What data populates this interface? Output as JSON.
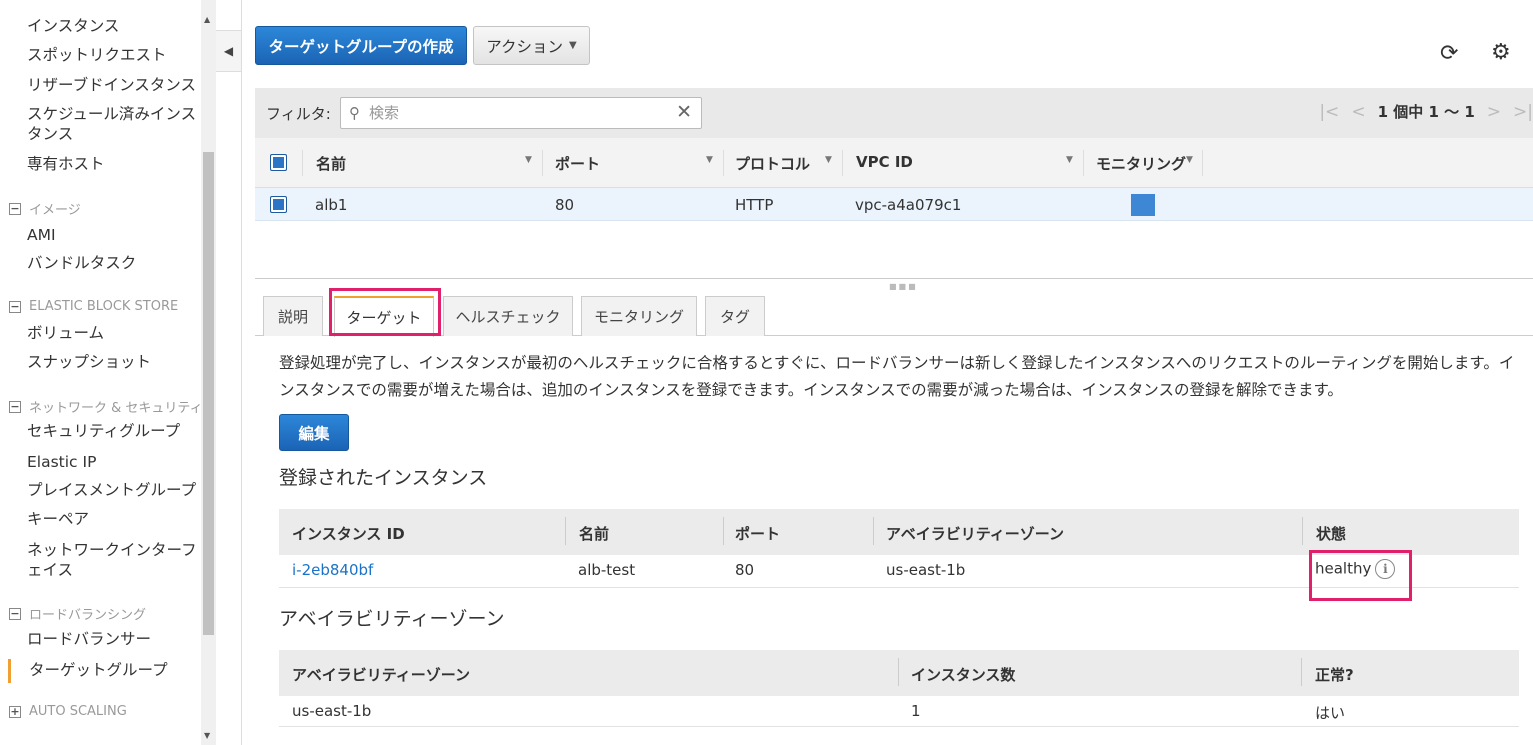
{
  "sidebar": {
    "items_top": [
      "インスタンス",
      "スポットリクエスト",
      "リザーブドインスタンス",
      "スケジュール済みインスタンス",
      "専有ホスト"
    ],
    "sec_images": "イメージ",
    "images_items": [
      "AMI",
      "バンドルタスク"
    ],
    "sec_ebs": "ELASTIC BLOCK STORE",
    "ebs_items": [
      "ボリューム",
      "スナップショット"
    ],
    "sec_network": "ネットワーク & セキュリティ",
    "network_items": [
      "セキュリティグループ",
      "Elastic IP",
      "プレイスメントグループ",
      "キーペア",
      "ネットワークインターフェイス"
    ],
    "sec_lb": "ロードバランシング",
    "lb_items": [
      "ロードバランサー",
      "ターゲットグループ"
    ],
    "sec_as": "AUTO SCALING"
  },
  "toolbar": {
    "create_label": "ターゲットグループの作成",
    "actions_label": "アクション"
  },
  "filter": {
    "label": "フィルタ:",
    "placeholder": "検索",
    "pager_text": "1 個中 1 〜 1"
  },
  "grid": {
    "columns": [
      "名前",
      "ポート",
      "プロトコル",
      "VPC ID",
      "モニタリング"
    ],
    "row": {
      "name": "alb1",
      "port": "80",
      "protocol": "HTTP",
      "vpc": "vpc-a4a079c1"
    }
  },
  "tabs": [
    "説明",
    "ターゲット",
    "ヘルスチェック",
    "モニタリング",
    "タグ"
  ],
  "targets": {
    "description": "登録処理が完了し、インスタンスが最初のヘルスチェックに合格するとすぐに、ロードバランサーは新しく登録したインスタンスへのリクエストのルーティングを開始します。インスタンスでの需要が増えた場合は、追加のインスタンスを登録できます。インスタンスでの需要が減った場合は、インスタンスの登録を解除できます。",
    "edit_label": "編集",
    "registered_title": "登録されたインスタンス",
    "registered_columns": [
      "インスタンス ID",
      "名前",
      "ポート",
      "アベイラビリティーゾーン",
      "状態"
    ],
    "registered_row": {
      "id": "i-2eb840bf",
      "name": "alb-test",
      "port": "80",
      "az": "us-east-1b",
      "status": "healthy"
    },
    "az_title": "アベイラビリティーゾーン",
    "az_columns": [
      "アベイラビリティーゾーン",
      "インスタンス数",
      "正常?"
    ],
    "az_row": {
      "az": "us-east-1b",
      "count": "1",
      "healthy": "はい"
    }
  },
  "colors": {
    "primary": "#1b64b5",
    "highlight": "#e0206b",
    "active_tab": "#f0a030"
  }
}
